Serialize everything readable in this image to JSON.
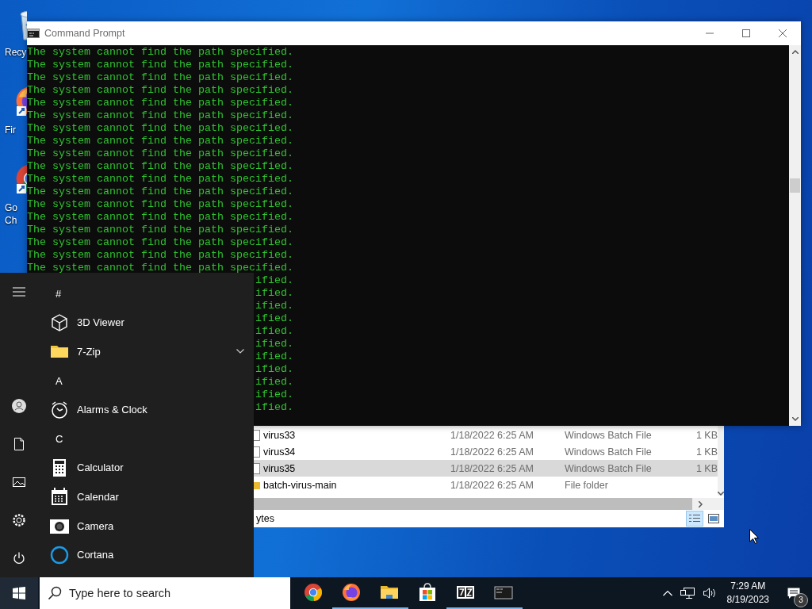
{
  "desktop_icons": [
    {
      "kind": "bin",
      "label_lines": [
        "Recy"
      ]
    },
    {
      "kind": "fox",
      "label_lines": [
        "Fir"
      ]
    },
    {
      "kind": "chrome",
      "label_lines": [
        "Go",
        "Ch"
      ]
    }
  ],
  "command_prompt": {
    "title": "Command Prompt",
    "lines": [
      "The system cannot find the path specified.",
      "The system cannot find the path specified.",
      "The system cannot find the path specified.",
      "The system cannot find the path specified.",
      "The system cannot find the path specified.",
      "The system cannot find the path specified.",
      "The system cannot find the path specified.",
      "The system cannot find the path specified.",
      "The system cannot find the path specified.",
      "The system cannot find the path specified.",
      "The system cannot find the path specified.",
      "The system cannot find the path specified.",
      "The system cannot find the path specified.",
      "The system cannot find the path specified.",
      "The system cannot find the path specified.",
      "The system cannot find the path specified.",
      "The system cannot find the path specified.",
      "The system cannot find the path specified."
    ],
    "lines_behind_start_menu": [
      "ified.",
      "ified.",
      "ified.",
      "ified.",
      "ified.",
      "ified.",
      "ified.",
      "ified.",
      "ified.",
      "ified.",
      "ified."
    ]
  },
  "explorer": {
    "rows": [
      {
        "kind": "file",
        "name": "virus33",
        "date": "1/18/2022 6:25 AM",
        "type": "Windows Batch File",
        "size": "1 KB",
        "selected": false
      },
      {
        "kind": "file",
        "name": "virus34",
        "date": "1/18/2022 6:25 AM",
        "type": "Windows Batch File",
        "size": "1 KB",
        "selected": false
      },
      {
        "kind": "file",
        "name": "virus35",
        "date": "1/18/2022 6:25 AM",
        "type": "Windows Batch File",
        "size": "1 KB",
        "selected": true
      },
      {
        "kind": "folder",
        "name": "batch-virus-main",
        "date": "1/18/2022 6:25 AM",
        "type": "File folder",
        "selected": false
      }
    ],
    "status": "ytes"
  },
  "start_menu": {
    "items": [
      {
        "kind": "header",
        "label": "#"
      },
      {
        "kind": "app",
        "label": "3D Viewer",
        "expandable": false
      },
      {
        "kind": "app",
        "label": "7-Zip",
        "expandable": true
      },
      {
        "kind": "header",
        "label": "A"
      },
      {
        "kind": "app",
        "label": "Alarms & Clock",
        "expandable": false
      },
      {
        "kind": "header",
        "label": "C"
      },
      {
        "kind": "app",
        "label": "Calculator",
        "expandable": false
      },
      {
        "kind": "app",
        "label": "Calendar",
        "expandable": false
      },
      {
        "kind": "app",
        "label": "Camera",
        "expandable": false
      },
      {
        "kind": "app",
        "label": "Cortana",
        "expandable": false
      }
    ]
  },
  "taskbar": {
    "search": {
      "placeholder": "Type here to search"
    },
    "apps": [
      {
        "kind": "chrome",
        "running": false
      },
      {
        "kind": "fox",
        "running": true
      },
      {
        "kind": "folder",
        "running": true
      },
      {
        "kind": "store",
        "running": false
      },
      {
        "kind": "zip",
        "running": true
      },
      {
        "kind": "console",
        "running": true
      }
    ],
    "clock": {
      "time": "7:29 AM",
      "date": "8/19/2023"
    },
    "notification_count": "3"
  }
}
